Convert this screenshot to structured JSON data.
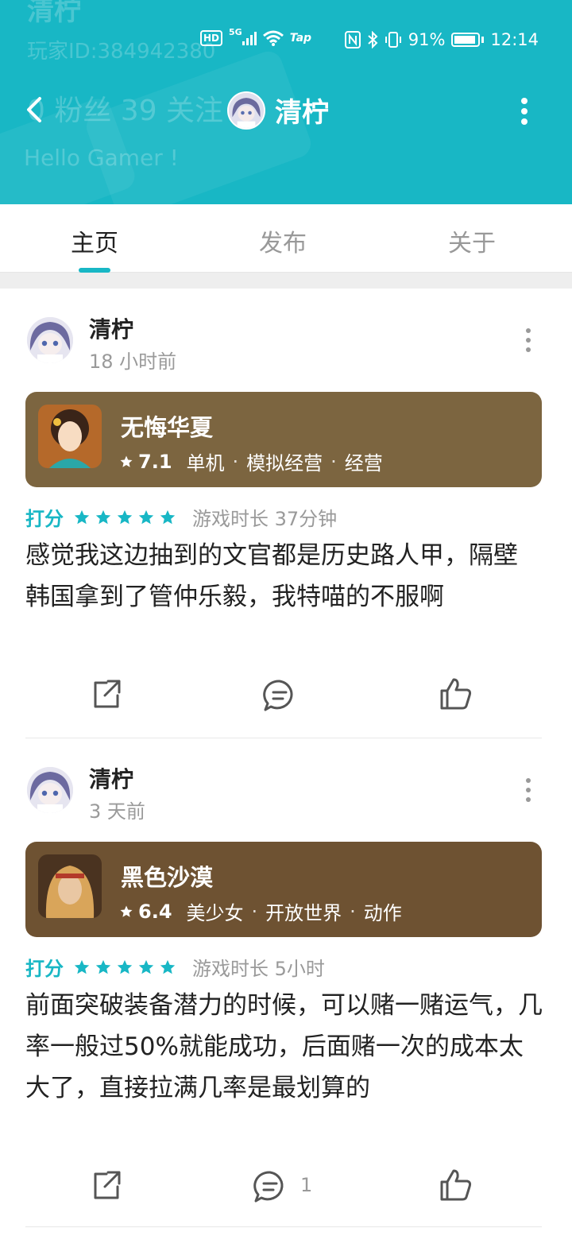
{
  "status_bar": {
    "hd": "HD",
    "network": "5G",
    "tap_label": "Tap",
    "battery_percent": "91%",
    "time": "12:14"
  },
  "header": {
    "ghost_title": "清柠",
    "ghost_id": "玩家ID:384942380",
    "ghost_stats": "0 粉丝   39 关注",
    "ghost_bio": "Hello Gamer !",
    "title": "清柠"
  },
  "tabs": [
    {
      "label": "主页",
      "active": true
    },
    {
      "label": "发布",
      "active": false
    },
    {
      "label": "关于",
      "active": false
    }
  ],
  "posts": [
    {
      "author": "清柠",
      "time": "18 小时前",
      "game": {
        "name": "无悔华夏",
        "score": "7.1",
        "tags": [
          "单机",
          "模拟经营",
          "经营"
        ],
        "card_color": "#7c6540"
      },
      "rating_label": "打分",
      "stars": 5,
      "playtime": "游戏时长 37分钟",
      "text": "感觉我这边抽到的文官都是历史路人甲，隔壁韩国拿到了管仲乐毅，我特喵的不服啊",
      "comment_count": ""
    },
    {
      "author": "清柠",
      "time": "3 天前",
      "game": {
        "name": "黑色沙漠",
        "score": "6.4",
        "tags": [
          "美少女",
          "开放世界",
          "动作"
        ],
        "card_color": "#6e5232"
      },
      "rating_label": "打分",
      "stars": 5,
      "playtime": "游戏时长 5小时",
      "text": "前面突破装备潜力的时候，可以赌一赌运气，几率一般过50%就能成功，后面赌一次的成本太大了，直接拉满几率是最划算的",
      "comment_count": "1"
    }
  ],
  "colors": {
    "accent": "#18b7c5",
    "star": "#18b7c5"
  }
}
